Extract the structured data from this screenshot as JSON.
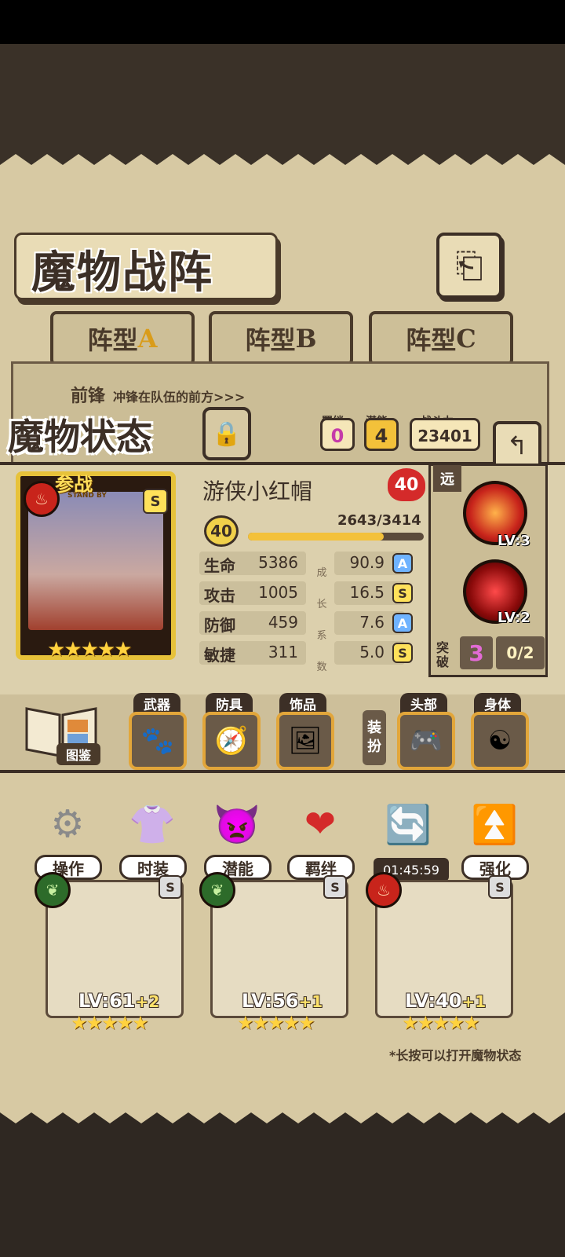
{
  "header": {
    "title": "魔物战阵"
  },
  "tabs": [
    {
      "prefix": "阵型",
      "suffix": "A"
    },
    {
      "prefix": "阵型",
      "suffix": "B"
    },
    {
      "prefix": "阵型",
      "suffix": "C"
    }
  ],
  "formation": {
    "row_title": "前锋",
    "row_desc": "冲锋在队伍的前方>>>"
  },
  "status": {
    "title": "魔物状态",
    "bond_label": "羁绊",
    "bond_value": "0",
    "potential_label": "潜能",
    "potential_value": "4",
    "power_label": "战斗力",
    "power_value": "23401"
  },
  "monster": {
    "name": "游侠小红帽",
    "affection": "40",
    "level": "40",
    "exp_text": "2643/3414",
    "exp_progress": 0.774,
    "standby_label": "参战",
    "standby_sub": "STAND BY",
    "rank": "S",
    "stars": "★★★★★",
    "element_color": "#c8241b"
  },
  "stats": [
    {
      "label": "生命",
      "value": "5386",
      "growth": "90.9",
      "grade": "A"
    },
    {
      "label": "攻击",
      "value": "1005",
      "growth": "16.5",
      "grade": "S"
    },
    {
      "label": "防御",
      "value": "459",
      "growth": "7.6",
      "grade": "A"
    },
    {
      "label": "敏捷",
      "value": "311",
      "growth": "5.0",
      "grade": "S"
    }
  ],
  "growth_vertical": "成长系数",
  "skills": {
    "range": "远",
    "skill1_lv": "LV:3",
    "skill2_lv": "LV:2"
  },
  "breakthrough": {
    "label": "突破",
    "count": "3",
    "progress": "0/2"
  },
  "equipment": {
    "book_label": "图鉴",
    "weapon_label": "武器",
    "armor_label": "防具",
    "accessory_label": "饰品",
    "dress_label": "装扮",
    "head_label": "头部",
    "body_label": "身体"
  },
  "actions": {
    "operate": "操作",
    "fashion": "时装",
    "potential": "潜能",
    "bond": "羁绊",
    "timer": "01:45:59",
    "enhance": "强化"
  },
  "roster": [
    {
      "lv": "LV:61",
      "plus": "+2",
      "rank": "S",
      "stars": "★★★★★",
      "element_color": "#2d6b2a"
    },
    {
      "lv": "LV:56",
      "plus": "+1",
      "rank": "S",
      "stars": "★★★★★",
      "element_color": "#2d6b2a"
    },
    {
      "lv": "LV:40",
      "plus": "+1",
      "rank": "S",
      "stars": "★★★★★",
      "element_color": "#c8241b"
    }
  ],
  "hint": "*长按可以打开魔物状态"
}
